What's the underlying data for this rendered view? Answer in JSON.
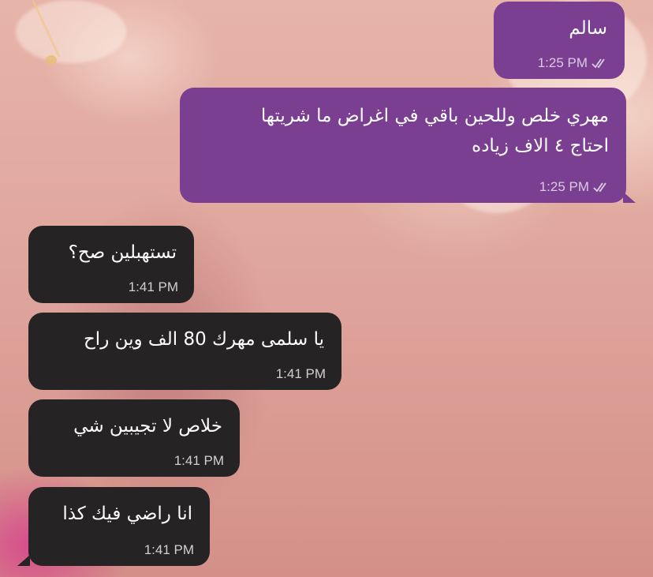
{
  "chat": {
    "messages": [
      {
        "direction": "outgoing",
        "text": "سالم",
        "time": "1:25 PM",
        "status_icon": "double-check-icon"
      },
      {
        "direction": "outgoing",
        "text_line1": "مهري خلص وللحين باقي في اغراض ما شريتها",
        "text_line2": "احتاج ٤ الاف زياده",
        "time": "1:25 PM",
        "status_icon": "double-check-icon"
      },
      {
        "direction": "incoming",
        "text": "تستهبلين صح؟",
        "time": "1:41 PM"
      },
      {
        "direction": "incoming",
        "text": "يا سلمى مهرك 80 الف وين راح",
        "time": "1:41 PM"
      },
      {
        "direction": "incoming",
        "text": "خلاص لا تجيبين شي",
        "time": "1:41 PM"
      },
      {
        "direction": "incoming",
        "text": "انا راضي فيك كذا",
        "time": "1:41 PM"
      }
    ]
  },
  "colors": {
    "outgoing_bubble": "#7a3f91",
    "incoming_bubble": "#262324",
    "text": "#ffffff"
  }
}
